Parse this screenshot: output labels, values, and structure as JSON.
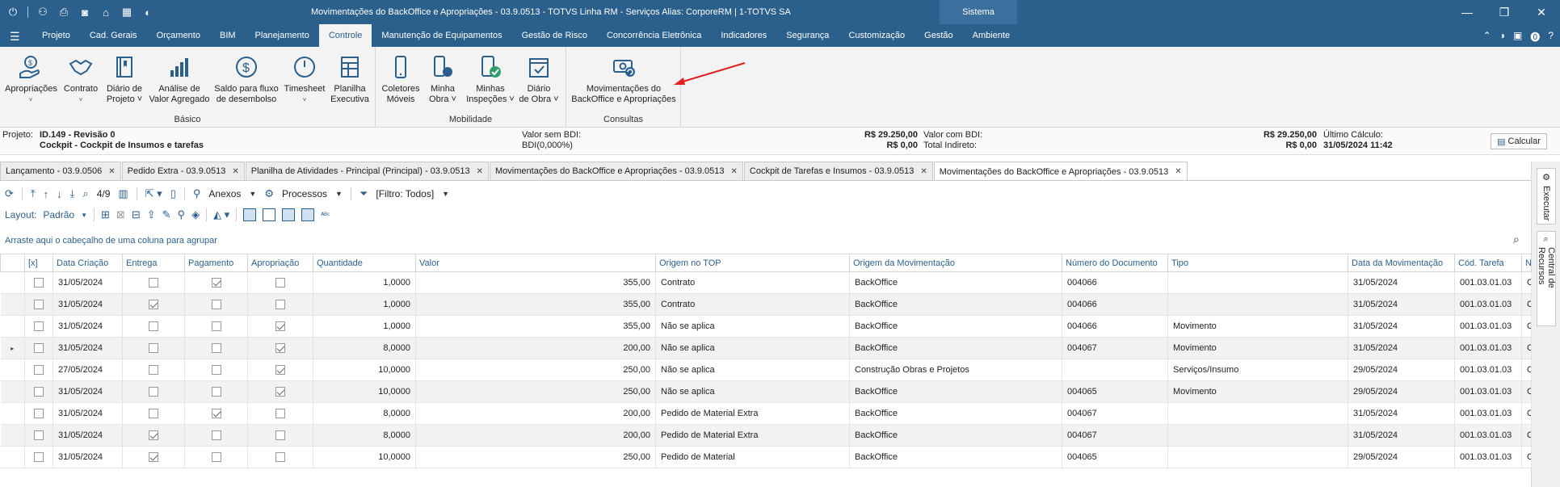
{
  "titlebar": {
    "title": "Movimentações do BackOffice e Apropriações - 03.9.0513 - TOTVS Linha RM - Serviços  Alias: CorporeRM | 1-TOTVS SA",
    "sistema": "Sistema"
  },
  "menu": {
    "tabs": [
      "Projeto",
      "Cad. Gerais",
      "Orçamento",
      "BIM",
      "Planejamento",
      "Controle",
      "Manutenção de Equipamentos",
      "Gestão de Risco",
      "Concorrência Eletrônica",
      "Indicadores",
      "Segurança",
      "Customização",
      "Gestão",
      "Ambiente"
    ],
    "active": "Controle"
  },
  "ribbon": {
    "basico": {
      "label": "Básico",
      "buttons": [
        {
          "l1": "Apropriações",
          "l2": "˅"
        },
        {
          "l1": "Contrato",
          "l2": "˅"
        },
        {
          "l1": "Diário de",
          "l2": "Projeto ˅"
        },
        {
          "l1": "Análise de",
          "l2": "Valor Agregado"
        },
        {
          "l1": "Saldo para fluxo",
          "l2": "de desembolso"
        },
        {
          "l1": "Timesheet",
          "l2": "˅"
        },
        {
          "l1": "Planilha",
          "l2": "Executiva"
        }
      ]
    },
    "mobilidade": {
      "label": "Mobilidade",
      "buttons": [
        {
          "l1": "Coletores",
          "l2": "Móveis"
        },
        {
          "l1": "Minha",
          "l2": "Obra ˅"
        },
        {
          "l1": "Minhas",
          "l2": "Inspeções ˅"
        },
        {
          "l1": "Diário",
          "l2": "de Obra ˅"
        }
      ]
    },
    "consultas": {
      "label": "Consultas",
      "buttons": [
        {
          "l1": "Movimentações do",
          "l2": "BackOffice e Apropriações"
        }
      ]
    }
  },
  "info": {
    "projeto_label": "Projeto:",
    "projeto_value": "ID.149 - Revisão 0",
    "cockpit": "Cockpit - Cockpit de Insumos e tarefas",
    "valor_sem_bdi_label": "Valor sem BDI:",
    "valor_sem_bdi": "R$ 29.250,00",
    "bdi_label": "BDI(0,000%)",
    "bdi_value": "R$ 0,00",
    "valor_com_bdi_label": "Valor com BDI:",
    "valor_com_bdi": "R$ 29.250,00",
    "total_indireto_label": "Total Indireto:",
    "total_indireto": "R$ 0,00",
    "ultimo_calculo_label": "Último Cálculo:",
    "ultimo_calculo": "31/05/2024 11:42",
    "calcular": "Calcular"
  },
  "doctabs": [
    "Lançamento - 03.9.0506",
    "Pedido Extra - 03.9.0513",
    "Planilha de Atividades - Principal (Principal) - 03.9.0513",
    "Movimentações do BackOffice e Apropriações - 03.9.0513",
    "Cockpit de Tarefas e Insumos - 03.9.0513",
    "Movimentações do BackOffice e Apropriações - 03.9.0513"
  ],
  "toolbar": {
    "record_count": "4/9",
    "anexos": "Anexos",
    "processos": "Processos",
    "filtro": "[Filtro: Todos]",
    "layout_label": "Layout:",
    "layout_value": "Padrão"
  },
  "group_hint": "Arraste aqui o cabeçalho de uma coluna para agrupar",
  "side": {
    "executar": "Executar",
    "central": "Central de Recursos"
  },
  "grid": {
    "columns": [
      "[x]",
      "Data Criação",
      "Entrega",
      "Pagamento",
      "Apropriação",
      "Quantidade",
      "Valor",
      "Origem no TOP",
      "Origem da Movimentação",
      "Número do Documento",
      "Tipo",
      "Data da Movimentação",
      "Cód. Tarefa",
      "No"
    ],
    "rows": [
      {
        "data": "31/05/2024",
        "entrega": false,
        "pagamento": true,
        "apropriacao": false,
        "qtd": "1,0000",
        "valor": "355,00",
        "origem_top": "Contrato",
        "origem_mov": "BackOffice",
        "doc": "004066",
        "tipo": "",
        "data_mov": "31/05/2024",
        "tarefa": "001.03.01.03",
        "no": "C"
      },
      {
        "data": "31/05/2024",
        "entrega": true,
        "pagamento": false,
        "apropriacao": false,
        "qtd": "1,0000",
        "valor": "355,00",
        "origem_top": "Contrato",
        "origem_mov": "BackOffice",
        "doc": "004066",
        "tipo": "",
        "data_mov": "31/05/2024",
        "tarefa": "001.03.01.03",
        "no": "C"
      },
      {
        "data": "31/05/2024",
        "entrega": false,
        "pagamento": false,
        "apropriacao": true,
        "qtd": "1,0000",
        "valor": "355,00",
        "origem_top": "Não se aplica",
        "origem_mov": "BackOffice",
        "doc": "004066",
        "tipo": "Movimento",
        "data_mov": "31/05/2024",
        "tarefa": "001.03.01.03",
        "no": "C"
      },
      {
        "data": "31/05/2024",
        "entrega": false,
        "pagamento": false,
        "apropriacao": true,
        "qtd": "8,0000",
        "valor": "200,00",
        "origem_top": "Não se aplica",
        "origem_mov": "BackOffice",
        "doc": "004067",
        "tipo": "Movimento",
        "data_mov": "31/05/2024",
        "tarefa": "001.03.01.03",
        "no": "C"
      },
      {
        "data": "27/05/2024",
        "entrega": false,
        "pagamento": false,
        "apropriacao": true,
        "qtd": "10,0000",
        "valor": "250,00",
        "origem_top": "Não se aplica",
        "origem_mov": "Construção Obras e Projetos",
        "doc": "",
        "tipo": "Serviços/Insumo",
        "data_mov": "29/05/2024",
        "tarefa": "001.03.01.03",
        "no": "C"
      },
      {
        "data": "31/05/2024",
        "entrega": false,
        "pagamento": false,
        "apropriacao": true,
        "qtd": "10,0000",
        "valor": "250,00",
        "origem_top": "Não se aplica",
        "origem_mov": "BackOffice",
        "doc": "004065",
        "tipo": "Movimento",
        "data_mov": "29/05/2024",
        "tarefa": "001.03.01.03",
        "no": "C"
      },
      {
        "data": "31/05/2024",
        "entrega": false,
        "pagamento": true,
        "apropriacao": false,
        "qtd": "8,0000",
        "valor": "200,00",
        "origem_top": "Pedido de Material Extra",
        "origem_mov": "BackOffice",
        "doc": "004067",
        "tipo": "",
        "data_mov": "31/05/2024",
        "tarefa": "001.03.01.03",
        "no": "C"
      },
      {
        "data": "31/05/2024",
        "entrega": true,
        "pagamento": false,
        "apropriacao": false,
        "qtd": "8,0000",
        "valor": "200,00",
        "origem_top": "Pedido de Material Extra",
        "origem_mov": "BackOffice",
        "doc": "004067",
        "tipo": "",
        "data_mov": "31/05/2024",
        "tarefa": "001.03.01.03",
        "no": "C"
      },
      {
        "data": "31/05/2024",
        "entrega": true,
        "pagamento": false,
        "apropriacao": false,
        "qtd": "10,0000",
        "valor": "250,00",
        "origem_top": "Pedido de Material",
        "origem_mov": "BackOffice",
        "doc": "004065",
        "tipo": "",
        "data_mov": "29/05/2024",
        "tarefa": "001.03.01.03",
        "no": "C"
      }
    ]
  },
  "colors": {
    "brand": "#2b5f8c",
    "accent_red": "#e02020"
  }
}
